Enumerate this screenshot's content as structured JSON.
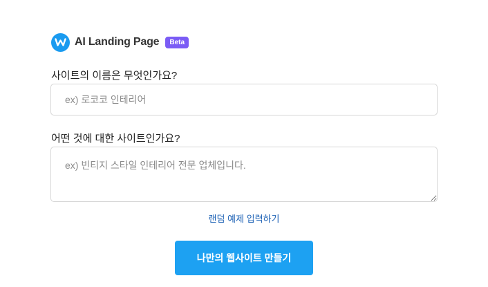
{
  "brand": {
    "title": "AI Landing Page",
    "badge": "Beta",
    "logo_icon": "w-logo-icon",
    "logo_color": "#1a9bf0",
    "badge_color": "#7b5cf5"
  },
  "form": {
    "name_label": "사이트의 이름은 무엇인가요?",
    "name_placeholder": "ex) 로코코 인테리어",
    "name_value": "",
    "desc_label": "어떤 것에 대한 사이트인가요?",
    "desc_placeholder": "ex) 빈티지 스타일 인테리어 전문 업체입니다.",
    "desc_value": "",
    "random_link": "랜덤 예제 입력하기",
    "submit_label": "나만의 웹사이트 만들기",
    "accent_color": "#1da1f2",
    "link_color": "#1f63b6"
  }
}
